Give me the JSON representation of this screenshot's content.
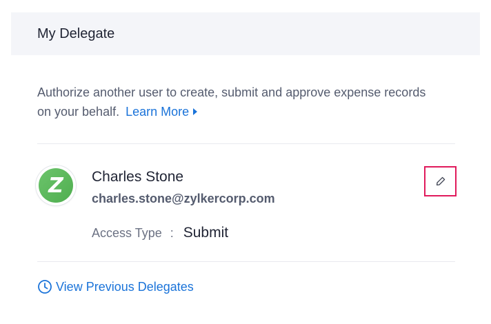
{
  "header": {
    "title": "My Delegate"
  },
  "description": {
    "text": "Authorize another user to create, submit and approve expense records on your behalf.",
    "learn_more_label": "Learn More",
    "learn_more_icon": "caret-right-icon"
  },
  "delegate": {
    "avatar_letter": "Z",
    "avatar_color": "#5cb85c",
    "name": "Charles Stone",
    "email": "charles.stone@zylkercorp.com",
    "access_type_label": "Access Type",
    "access_type_separator": ":",
    "access_type_value": "Submit",
    "edit_icon": "pencil-icon",
    "edit_highlight_color": "#e0195b"
  },
  "footer": {
    "view_previous_label": "View Previous Delegates",
    "view_previous_icon": "clock-icon"
  },
  "colors": {
    "link": "#1a73d9",
    "header_bg": "#f4f5f9",
    "divider": "#e8e9ee"
  }
}
